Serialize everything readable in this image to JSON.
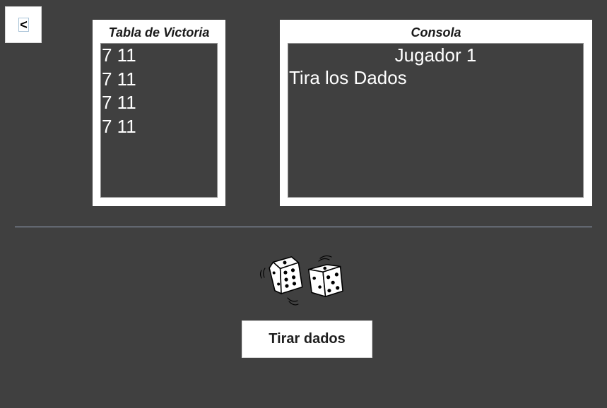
{
  "back_button": {
    "label": "<"
  },
  "victory_table": {
    "title": "Tabla de Victoria",
    "rows": [
      "7 11",
      "7 11",
      "7 11",
      "7 11"
    ]
  },
  "console": {
    "title": "Consola",
    "player": "Jugador 1",
    "message": "Tira los Dados"
  },
  "dice_icon": "rolling-dice-icon",
  "roll_button": {
    "label": "Tirar dados"
  },
  "colors": {
    "background": "#404040",
    "panel": "#ffffff",
    "divider": "#9aa8c0"
  }
}
